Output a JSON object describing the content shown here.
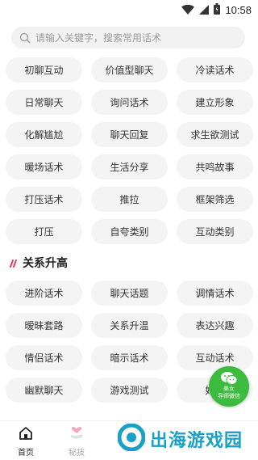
{
  "status_bar": {
    "time": "10:58"
  },
  "search": {
    "placeholder": "请输入关键字，搜索常用话术"
  },
  "categories_a": [
    "初聊互动",
    "价值型聊天",
    "冷读话术",
    "日常聊天",
    "询问话术",
    "建立形象",
    "化解尴尬",
    "聊天回复",
    "求生欲测试",
    "暖场话术",
    "生活分享",
    "共鸣故事",
    "打压话术",
    "推拉",
    "框架筛选",
    "打压",
    "自夸类别",
    "互动类别"
  ],
  "section_b": {
    "title": "关系升高",
    "accent": "#e23a6a"
  },
  "categories_b": [
    "进阶话术",
    "聊天话题",
    "调情话术",
    "暧昧套路",
    "关系升温",
    "表达兴趣",
    "情侣话术",
    "暗示话术",
    "互动话术",
    "幽默聊天",
    "游戏测试",
    "好感"
  ],
  "wechat_float": {
    "line1": "美女",
    "line2": "导师微信",
    "color": "#3dbb3f"
  },
  "tabs": [
    {
      "label": "首页",
      "icon": "home-icon",
      "active": true
    },
    {
      "label": "秘技",
      "icon": "heart-hand-icon",
      "active": false
    }
  ],
  "watermark": {
    "text": "出海游戏园"
  }
}
